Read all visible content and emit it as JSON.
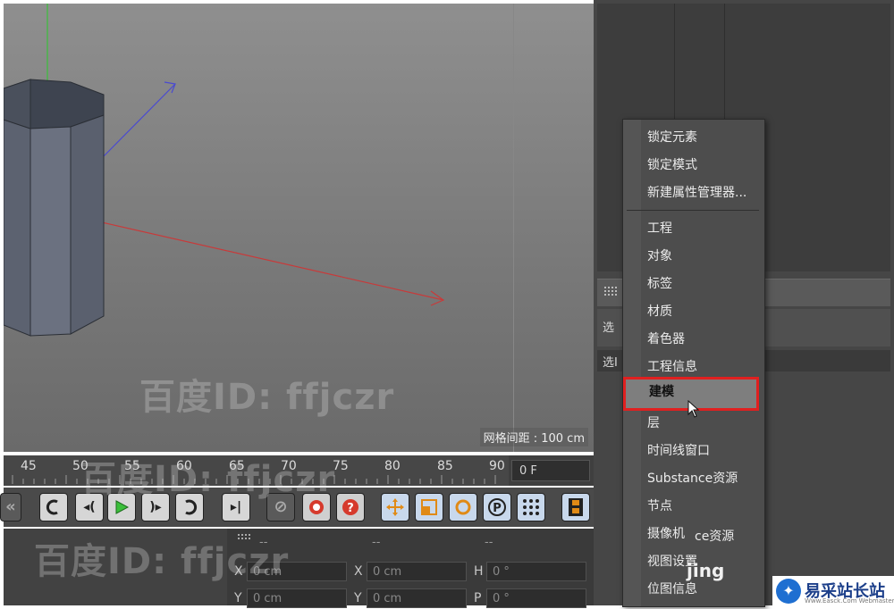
{
  "viewport": {
    "grid_spacing_label": "网格间距 : 100 cm"
  },
  "timeline": {
    "ticks": [
      "45",
      "50",
      "55",
      "60",
      "65",
      "70",
      "75",
      "80",
      "85",
      "90"
    ],
    "current_frame": "0 F"
  },
  "right_panel": {
    "side_tab_1": "选",
    "side_tab_2": "选I"
  },
  "coords": {
    "dash": "--",
    "x_label": "X",
    "y_label": "Y",
    "h_label": "H",
    "p_label": "P",
    "x_pos": "0 cm",
    "x_size": "0 cm",
    "h_rot": "0 °",
    "y_pos": "0 cm",
    "y_size": "0 cm",
    "p_rot": "0 °"
  },
  "context_menu": {
    "items": [
      "锁定元素",
      "锁定模式",
      "新建属性管理器...",
      "工程",
      "对象",
      "标签",
      "材质",
      "着色器",
      "工程信息",
      "建模",
      "层",
      "时间线窗口",
      "Substance资源",
      "节点",
      "摄像机",
      "视图设置",
      "位图信息"
    ],
    "overlap_fragment": "ce资源",
    "highlighted": "建模"
  },
  "watermark": {
    "text": "百度ID: ffjczr",
    "fragment": "jing"
  },
  "brand": {
    "name": "易采站长站",
    "url": "Www.Easck.Com  Webmaster"
  },
  "colors": {
    "highlight_border": "#e02020",
    "axis_red": "#c83a3a",
    "axis_blue": "#4a4ad0",
    "axis_green": "#3bbf3b",
    "brand_blue": "#1f6fd1"
  },
  "icons": [
    "play-icon",
    "loop-icon",
    "move-icon",
    "scale-icon",
    "rotate-icon",
    "record-icon",
    "help-icon"
  ]
}
